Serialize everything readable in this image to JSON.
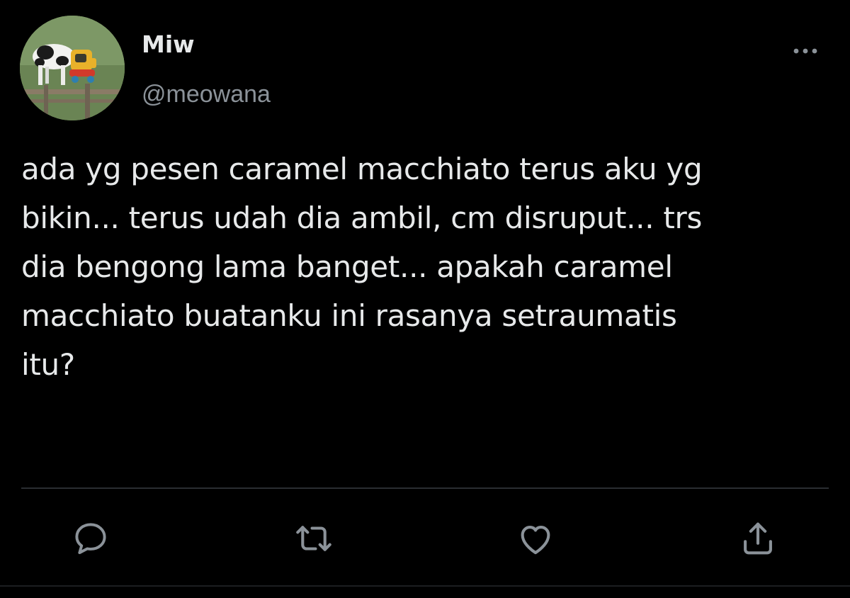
{
  "tweet": {
    "author": {
      "display_name": "Miw",
      "handle": "@meowana",
      "avatar_icon": "cow-avatar"
    },
    "text": "ada yg pesen caramel macchiato terus aku yg\nbikin... terus udah dia ambil, cm disruput... trs\ndia bengong lama banget... apakah caramel\nmacchiato buatanku ini rasanya setraumatis\nitu?",
    "more_icon": "more-horizontal-icon",
    "actions": [
      {
        "name": "reply",
        "icon": "comment-bubble-icon"
      },
      {
        "name": "retweet",
        "icon": "retweet-arrows-icon"
      },
      {
        "name": "like",
        "icon": "heart-icon"
      },
      {
        "name": "share",
        "icon": "share-upload-icon"
      }
    ]
  },
  "colors": {
    "background": "#000000",
    "text": "#e7e9ea",
    "secondary_text": "#8b9299",
    "icon": "#8b9299",
    "divider": "#2a2d31"
  }
}
